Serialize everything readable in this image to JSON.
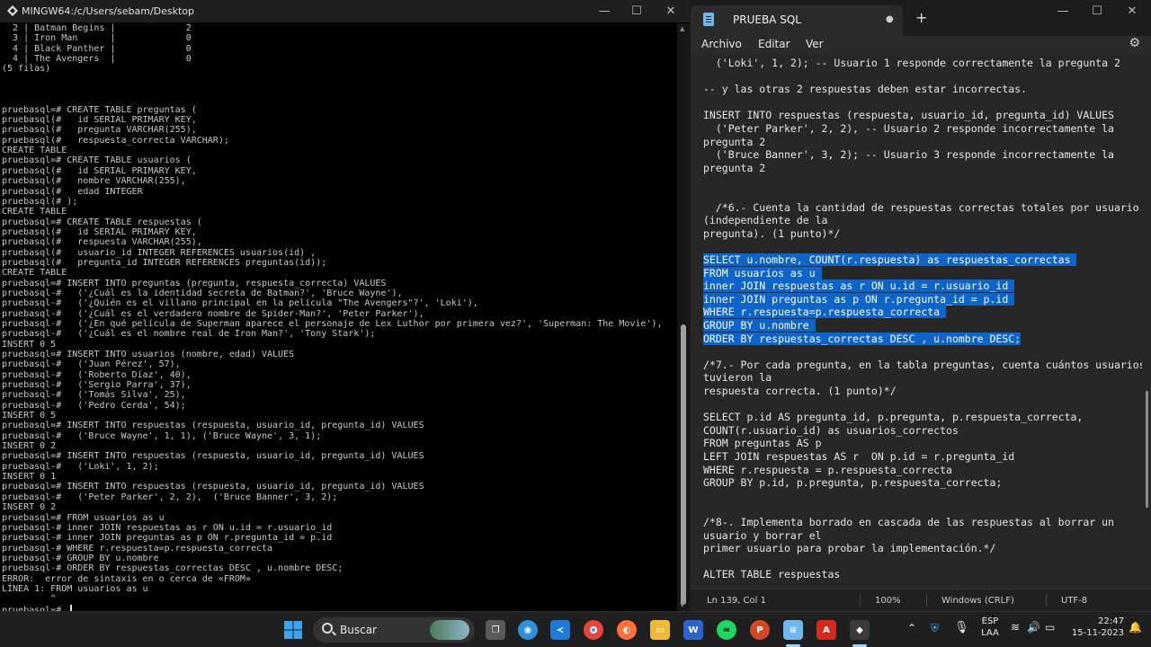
{
  "terminal": {
    "title": "MINGW64:/c/Users/sebam/Desktop",
    "lines": [
      "  2 | Batman Begins |             2",
      "  3 | Iron Man      |             0",
      "  4 | Black Panther |             0",
      "  4 | The Avengers  |             0",
      "(5 filas)",
      "",
      "",
      "",
      "pruebasql=# CREATE TABLE preguntas (",
      "pruebasql(#   id SERIAL PRIMARY KEY,",
      "pruebasql(#   pregunta VARCHAR(255),",
      "pruebasql(#   respuesta_correcta VARCHAR);",
      "CREATE TABLE",
      "pruebasql=# CREATE TABLE usuarios (",
      "pruebasql(#   id SERIAL PRIMARY KEY,",
      "pruebasql(#   nombre VARCHAR(255),",
      "pruebasql(#   edad INTEGER",
      "pruebasql(# );",
      "CREATE TABLE",
      "pruebasql=# CREATE TABLE respuestas (",
      "pruebasql(#   id SERIAL PRIMARY KEY,",
      "pruebasql(#   respuesta VARCHAR(255),",
      "pruebasql(#   usuario_id INTEGER REFERENCES usuarios(id) ,",
      "pruebasql(#   pregunta_id INTEGER REFERENCES preguntas(id));",
      "CREATE TABLE",
      "pruebasql=# INSERT INTO preguntas (pregunta, respuesta_correcta) VALUES",
      "pruebasql-#   ('¿Cuál es la identidad secreta de Batman?', 'Bruce Wayne'),",
      "pruebasql-#   ('¿Quién es el villano principal en la película \"The Avengers\"?', 'Loki'),",
      "pruebasql-#   ('¿Cuál es el verdadero nombre de Spider-Man?', 'Peter Parker'),",
      "pruebasql-#   ('¿En qué película de Superman aparece el personaje de Lex Luthor por primera vez?', 'Superman: The Movie'),",
      "pruebasql-#   ('¿Cuál es el nombre real de Iron Man?', 'Tony Stark');",
      "INSERT 0 5",
      "pruebasql=# INSERT INTO usuarios (nombre, edad) VALUES",
      "pruebasql-#   ('Juan Pérez', 57),",
      "pruebasql-#   ('Roberto Díaz', 40),",
      "pruebasql-#   ('Sergio Parra', 37),",
      "pruebasql-#   ('Tomás Silva', 25),",
      "pruebasql-#   ('Pedro Cerda', 54);",
      "INSERT 0 5",
      "pruebasql=# INSERT INTO respuestas (respuesta, usuario_id, pregunta_id) VALUES",
      "pruebasql-#   ('Bruce Wayne', 1, 1), ('Bruce Wayne', 3, 1);",
      "INSERT 0 2",
      "pruebasql=# INSERT INTO respuestas (respuesta, usuario_id, pregunta_id) VALUES",
      "pruebasql-#   ('Loki', 1, 2);",
      "INSERT 0 1",
      "pruebasql=# INSERT INTO respuestas (respuesta, usuario_id, pregunta_id) VALUES",
      "pruebasql-#   ('Peter Parker', 2, 2),  ('Bruce Banner', 3, 2);",
      "INSERT 0 2",
      "pruebasql=# FROM usuarios as u",
      "pruebasql-# inner JOIN respuestas as r ON u.id = r.usuario_id",
      "pruebasql-# inner JOIN preguntas as p ON r.pregunta_id = p.id",
      "pruebasql-# WHERE r.respuesta=p.respuesta_correcta",
      "pruebasql-# GROUP BY u.nombre",
      "pruebasql-# ORDER BY respuestas_correctas DESC , u.nombre DESC;",
      "ERROR:  error de sintaxis en o cerca de «FROM»",
      "LÍNEA 1: FROM usuarios as u",
      "         ^",
      "pruebasql=# "
    ]
  },
  "notepad": {
    "tab_title": "PRUEBA SQL",
    "tab_dot": "●",
    "new_tab": "+",
    "menu": [
      "Archivo",
      "Editar",
      "Ver"
    ],
    "lines": [
      {
        "text": "  ('Loki', 1, 2); -- Usuario 1 responde correctamente la pregunta 2",
        "sel": false
      },
      {
        "text": "",
        "sel": false
      },
      {
        "text": "-- y las otras 2 respuestas deben estar incorrectas.",
        "sel": false
      },
      {
        "text": "",
        "sel": false
      },
      {
        "text": "INSERT INTO respuestas (respuesta, usuario_id, pregunta_id) VALUES",
        "sel": false
      },
      {
        "text": "  ('Peter Parker', 2, 2), -- Usuario 2 responde incorrectamente la",
        "sel": false
      },
      {
        "text": "pregunta 2",
        "sel": false
      },
      {
        "text": "  ('Bruce Banner', 3, 2); -- Usuario 3 responde incorrectamente la",
        "sel": false
      },
      {
        "text": "pregunta 2",
        "sel": false
      },
      {
        "text": "",
        "sel": false
      },
      {
        "text": "",
        "sel": false
      },
      {
        "text": "  /*6.- Cuenta la cantidad de respuestas correctas totales por usuario",
        "sel": false
      },
      {
        "text": "(independiente de la",
        "sel": false
      },
      {
        "text": "pregunta). (1 punto)*/",
        "sel": false
      },
      {
        "text": "",
        "sel": false
      },
      {
        "text": "SELECT u.nombre, COUNT(r.respuesta) as respuestas_correctas ",
        "sel": true
      },
      {
        "text": "FROM usuarios as u ",
        "sel": true
      },
      {
        "text": "inner JOIN respuestas as r ON u.id = r.usuario_id ",
        "sel": true
      },
      {
        "text": "inner JOIN preguntas as p ON r.pregunta_id = p.id ",
        "sel": true
      },
      {
        "text": "WHERE r.respuesta=p.respuesta_correcta ",
        "sel": true
      },
      {
        "text": "GROUP BY u.nombre ",
        "sel": true
      },
      {
        "text": "ORDER BY respuestas_correctas DESC , u.nombre DESC;",
        "sel": true
      },
      {
        "text": "",
        "sel": false
      },
      {
        "text": "/*7.- Por cada pregunta, en la tabla preguntas, cuenta cuántos usuarios",
        "sel": false
      },
      {
        "text": "tuvieron la",
        "sel": false
      },
      {
        "text": "respuesta correcta. (1 punto)*/",
        "sel": false
      },
      {
        "text": "",
        "sel": false
      },
      {
        "text": "SELECT p.id AS pregunta_id, p.pregunta, p.respuesta_correcta,",
        "sel": false
      },
      {
        "text": "COUNT(r.usuario_id) as usuarios_correctos",
        "sel": false
      },
      {
        "text": "FROM preguntas AS p",
        "sel": false
      },
      {
        "text": "LEFT JOIN respuestas AS r  ON p.id = r.pregunta_id",
        "sel": false
      },
      {
        "text": "WHERE r.respuesta = p.respuesta_correcta",
        "sel": false
      },
      {
        "text": "GROUP BY p.id, p.pregunta, p.respuesta_correcta;",
        "sel": false
      },
      {
        "text": "",
        "sel": false
      },
      {
        "text": "",
        "sel": false
      },
      {
        "text": "/*8-. Implementa borrado en cascada de las respuestas al borrar un",
        "sel": false
      },
      {
        "text": "usuario y borrar el",
        "sel": false
      },
      {
        "text": "primer usuario para probar la implementación.*/",
        "sel": false
      },
      {
        "text": "",
        "sel": false
      },
      {
        "text": "ALTER TABLE respuestas",
        "sel": false
      }
    ],
    "status": {
      "position": "Ln 139, Col 1",
      "zoom": "100%",
      "line_endings": "Windows (CRLF)",
      "encoding": "UTF-8"
    }
  },
  "taskbar": {
    "search_label": "Buscar",
    "language": "ESP",
    "layout": "LAA",
    "time": "22:47",
    "date": "15-11-2023"
  }
}
